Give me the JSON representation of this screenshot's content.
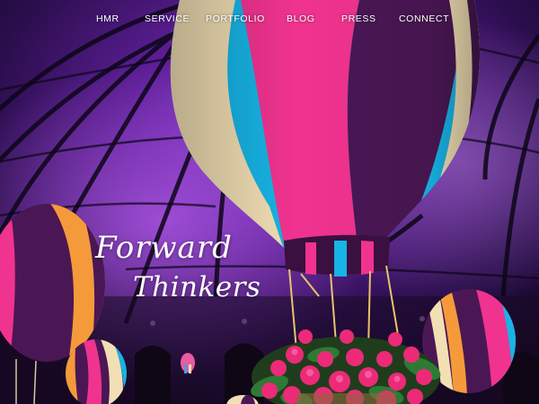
{
  "nav": {
    "items": [
      {
        "id": "hmr",
        "label": "HMR"
      },
      {
        "id": "service",
        "label": "SERVICE"
      },
      {
        "id": "portfolio",
        "label": "PORTFOLIO"
      },
      {
        "id": "blog",
        "label": "BLOG"
      },
      {
        "id": "press",
        "label": "PRESS"
      },
      {
        "id": "connect",
        "label": "CONNECT"
      }
    ]
  },
  "hero": {
    "wordmark_line1": "Forward",
    "wordmark_line2": "Thinkers"
  },
  "colors": {
    "ceiling_purple": "#3a1460",
    "ceiling_violet": "#7b2bb8",
    "balloon_cyan": "#17b4e6",
    "balloon_magenta": "#f0338f",
    "balloon_plum": "#4a1754",
    "balloon_cream": "#f2dfb4",
    "balloon_orange": "#f59a3b",
    "flower_pink": "#ec2a78",
    "leaf_green": "#2e7a35",
    "text_white": "#ffffff"
  }
}
